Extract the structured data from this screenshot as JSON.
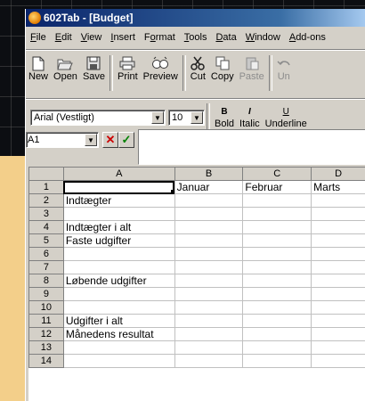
{
  "window": {
    "title": "602Tab - [Budget]"
  },
  "menubar": {
    "items": [
      {
        "pre": "",
        "u": "F",
        "post": "ile"
      },
      {
        "pre": "",
        "u": "E",
        "post": "dit"
      },
      {
        "pre": "",
        "u": "V",
        "post": "iew"
      },
      {
        "pre": "",
        "u": "I",
        "post": "nsert"
      },
      {
        "pre": "F",
        "u": "o",
        "post": "rmat"
      },
      {
        "pre": "",
        "u": "T",
        "post": "ools"
      },
      {
        "pre": "",
        "u": "D",
        "post": "ata"
      },
      {
        "pre": "",
        "u": "W",
        "post": "indow"
      },
      {
        "pre": "",
        "u": "A",
        "post": "dd-ons"
      }
    ]
  },
  "toolbar": {
    "new": "New",
    "open": "Open",
    "save": "Save",
    "print": "Print",
    "preview": "Preview",
    "cut": "Cut",
    "copy": "Copy",
    "paste": "Paste",
    "undo": "Un"
  },
  "formatbar": {
    "font": "Arial (Vestligt)",
    "size": "10",
    "bold": "Bold",
    "italic": "Italic",
    "underline": "Underline",
    "bold_glyph": "B",
    "italic_glyph": "I",
    "underline_glyph": "U"
  },
  "cellbar": {
    "name_box": "A1",
    "cancel_glyph": "✕",
    "confirm_glyph": "✓",
    "formula": ""
  },
  "sheet": {
    "columns": [
      "A",
      "B",
      "C",
      "D"
    ],
    "rows": [
      {
        "n": "1",
        "a": "",
        "b": "Januar",
        "c": "Februar",
        "d": "Marts"
      },
      {
        "n": "2",
        "a": "Indtægter",
        "b": "",
        "c": "",
        "d": ""
      },
      {
        "n": "3",
        "a": "",
        "b": "",
        "c": "",
        "d": ""
      },
      {
        "n": "4",
        "a": "Indtægter i alt",
        "b": "",
        "c": "",
        "d": ""
      },
      {
        "n": "5",
        "a": "Faste udgifter",
        "b": "",
        "c": "",
        "d": ""
      },
      {
        "n": "6",
        "a": "",
        "b": "",
        "c": "",
        "d": ""
      },
      {
        "n": "7",
        "a": "",
        "b": "",
        "c": "",
        "d": ""
      },
      {
        "n": "8",
        "a": "Løbende udgifter",
        "b": "",
        "c": "",
        "d": ""
      },
      {
        "n": "9",
        "a": "",
        "b": "",
        "c": "",
        "d": ""
      },
      {
        "n": "10",
        "a": "",
        "b": "",
        "c": "",
        "d": ""
      },
      {
        "n": "11",
        "a": "Udgifter i alt",
        "b": "",
        "c": "",
        "d": ""
      },
      {
        "n": "12",
        "a": "Månedens resultat",
        "b": "",
        "c": "",
        "d": ""
      },
      {
        "n": "13",
        "a": "",
        "b": "",
        "c": "",
        "d": ""
      },
      {
        "n": "14",
        "a": "",
        "b": "",
        "c": "",
        "d": ""
      }
    ]
  }
}
